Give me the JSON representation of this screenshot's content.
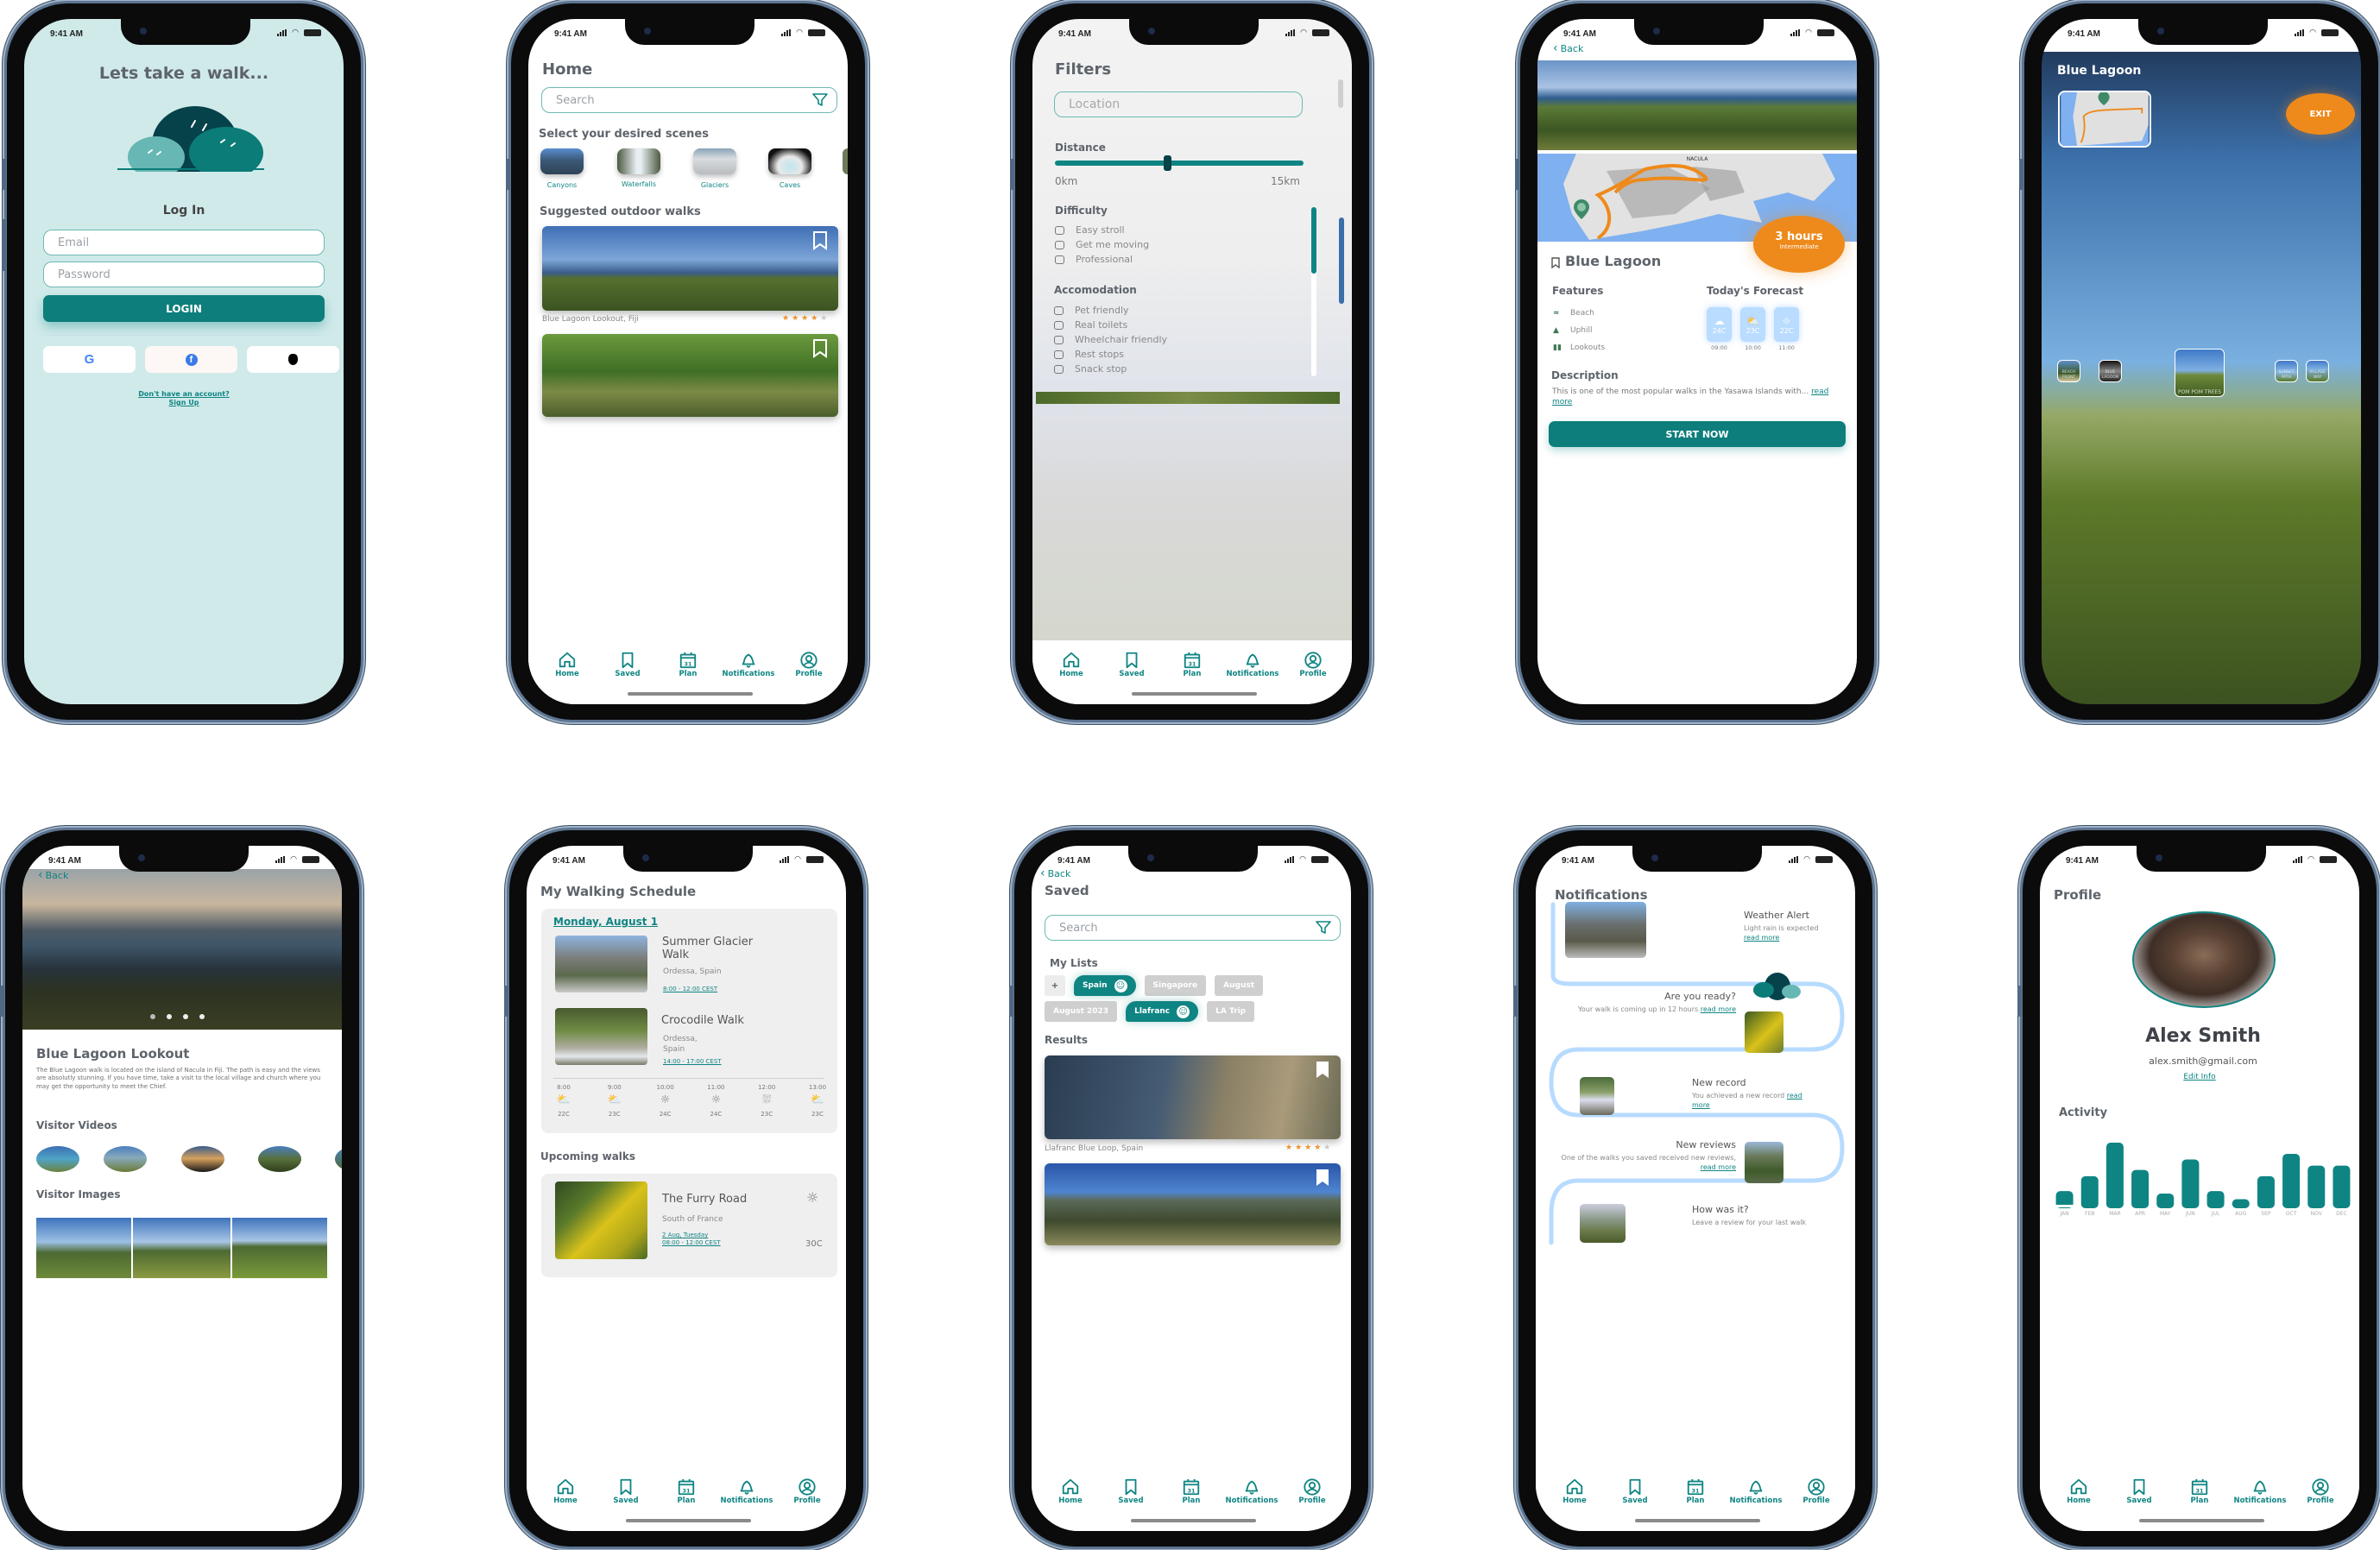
{
  "status_bar": {
    "time": "9:41 AM"
  },
  "tab_bar": {
    "items": [
      {
        "label": "Home",
        "icon": "home-icon"
      },
      {
        "label": "Saved",
        "icon": "bookmark-icon"
      },
      {
        "label": "Plan",
        "icon": "calendar-icon",
        "badge": "31"
      },
      {
        "label": "Notifications",
        "icon": "bell-icon"
      },
      {
        "label": "Profile",
        "icon": "profile-icon"
      }
    ]
  },
  "colors": {
    "teal": "#0f8583",
    "dark_teal": "#05424a",
    "orange": "#ee8a1b",
    "login_bg": "#d0eaea",
    "weather_blue": "#b9dcff"
  },
  "login": {
    "headline": "Lets take a walk...",
    "subtitle": "Log In",
    "email_placeholder": "Email",
    "password_placeholder": "Password",
    "login_button": "LOGIN",
    "social": [
      {
        "name": "Google",
        "icon": "google-icon"
      },
      {
        "name": "Facebook",
        "icon": "facebook-icon"
      },
      {
        "name": "Apple",
        "icon": "apple-icon"
      }
    ],
    "signup_line1": "Don't have an account?",
    "signup_line2": "Sign Up"
  },
  "home": {
    "title": "Home",
    "search_placeholder": "Search",
    "scenes_heading": "Select your desired scenes",
    "scenes": [
      {
        "label": "Canyons"
      },
      {
        "label": "Waterfalls"
      },
      {
        "label": "Glaciers"
      },
      {
        "label": "Caves"
      }
    ],
    "suggested_heading": "Suggested outdoor walks",
    "walks": [
      {
        "name": "Blue Lagoon Lookout, Fiji",
        "rating": 4,
        "max_rating": 5
      },
      {
        "name": "",
        "rating": null
      }
    ]
  },
  "filters": {
    "title": "Filters",
    "location_placeholder": "Location",
    "distance_label": "Distance",
    "distance_min": "0km",
    "distance_max": "15km",
    "distance_value_fraction": 0.45,
    "difficulty_label": "Difficulty",
    "difficulty_options": [
      "Easy stroll",
      "Get me moving",
      "Professional"
    ],
    "accommodation_label": "Accomodation",
    "accommodation_options": [
      "Pet friendly",
      "Real toilets",
      "Wheelchair friendly",
      "Rest stops",
      "Snack stop"
    ]
  },
  "detail": {
    "back": "Back",
    "map_label": "NACULA",
    "duration": "3 hours",
    "level": "Intermediate",
    "title": "Blue Lagoon",
    "features_heading": "Features",
    "features": [
      {
        "label": "Beach",
        "icon": "swimmer-icon"
      },
      {
        "label": "Uphill",
        "icon": "mountain-icon"
      },
      {
        "label": "Lookouts",
        "icon": "binoculars-icon"
      }
    ],
    "forecast_heading": "Today's Forecast",
    "forecast": [
      {
        "temp": "24C",
        "time": "09:00",
        "icon": "cloud-icon"
      },
      {
        "temp": "23C",
        "time": "10:00",
        "icon": "partly-sunny-icon"
      },
      {
        "temp": "22C",
        "time": "11:00",
        "icon": "sun-icon"
      }
    ],
    "description_heading": "Description",
    "description": "This is one of the most popular walks in the Yasawa Islands with...",
    "read_more": "read more",
    "start_button": "START NOW"
  },
  "navigation": {
    "title": "Blue Lagoon",
    "exit_button": "EXIT",
    "thumbnails": [
      "BEACH FRONT",
      "BLUE LAGOON",
      "POM POM TREES",
      "SUNSET PATH",
      "VILLAGE WAY"
    ],
    "active_thumbnail": "POM POM TREES"
  },
  "lookout": {
    "back": "Back",
    "title": "Blue Lagoon Lookout",
    "description": "The Blue Lagoon walk is located on the island of Nacula in Fiji.  The path is easy and the views are absolutly stunning.  If you have time, take a visit to the local village and church where you may get the opportunity to meet the Chief.",
    "carousel_dots": 4,
    "videos_heading": "Visitor Videos",
    "images_heading": "Visitor Images"
  },
  "schedule": {
    "title": "My Walking Schedule",
    "date": "Monday, August 1",
    "walks": [
      {
        "name": "Summer Glacier Walk",
        "location": "Ordessa, Spain",
        "time": "8:00 - 12:00 CEST"
      },
      {
        "name": "Crocodile Walk",
        "location": "Ordessa, Spain",
        "time": "14:00 - 17:00 CEST"
      }
    ],
    "hourly": [
      {
        "time": "8:00",
        "icon": "partly-sunny-icon",
        "temp": "22C"
      },
      {
        "time": "9:00",
        "icon": "partly-sunny-icon",
        "temp": "23C"
      },
      {
        "time": "10:00",
        "icon": "sun-icon",
        "temp": "24C"
      },
      {
        "time": "11:00",
        "icon": "sun-icon",
        "temp": "24C"
      },
      {
        "time": "12:00",
        "icon": "rain-icon",
        "temp": "23C"
      },
      {
        "time": "13:00",
        "icon": "partly-sunny-icon",
        "temp": "23C"
      }
    ],
    "upcoming_heading": "Upcoming walks",
    "upcoming": [
      {
        "name": "The Furry Road",
        "location": "South of France",
        "date": "2 Aug, Tuesday",
        "time": "08:00 - 12:00 CEST",
        "temp": "30C",
        "icon": "sun-icon"
      }
    ]
  },
  "saved": {
    "back": "Back",
    "title": "Saved",
    "search_placeholder": "Search",
    "lists_heading": "My Lists",
    "add_label": "+",
    "lists_row1": [
      {
        "label": "Spain",
        "active": true
      },
      {
        "label": "Singapore",
        "active": false
      },
      {
        "label": "August",
        "active": false
      }
    ],
    "lists_row2": [
      {
        "label": "August 2023",
        "active": false
      },
      {
        "label": "Llafranc",
        "active": true
      },
      {
        "label": "LA Trip",
        "active": false
      }
    ],
    "results_heading": "Results",
    "results": [
      {
        "name": "Llafranc Blue Loop, Spain",
        "rating": 4,
        "max_rating": 5
      },
      {
        "name": "",
        "rating": null
      }
    ]
  },
  "notifications": {
    "title": "Notifications",
    "items": [
      {
        "title": "Weather Alert",
        "body": "Light rain is expected",
        "link": "read more"
      },
      {
        "title": "Are you ready?",
        "body": "Your walk is coming up in 12 hours",
        "link": "read more"
      },
      {
        "title": "New record",
        "body": "You achieved a new record",
        "link": "read more"
      },
      {
        "title": "New reviews",
        "body": "One of the walks you saved received new reviews,",
        "link": "read more"
      },
      {
        "title": "How was it?",
        "body": "Leave a review for your last walk",
        "link": ""
      }
    ]
  },
  "profile": {
    "title": "Profile",
    "name": "Alex Smith",
    "email": "alex.smith@gmail.com",
    "edit_link": "Edit Info",
    "activity_heading": "Activity"
  },
  "chart_data": {
    "type": "bar",
    "title": "Activity",
    "categories": [
      "JAN",
      "FEB",
      "MAR",
      "APR",
      "MAY",
      "JUN",
      "JUL",
      "AUG",
      "SEP",
      "OCT",
      "NOV",
      "DEC"
    ],
    "values": [
      2.2,
      4.6,
      10,
      5.6,
      1.8,
      7.3,
      2.2,
      0.9,
      4.6,
      8.2,
      6.3,
      6.3
    ],
    "xlabel": "",
    "ylabel": "",
    "ylim": [
      0,
      10
    ],
    "grid": false,
    "legend": "none"
  }
}
